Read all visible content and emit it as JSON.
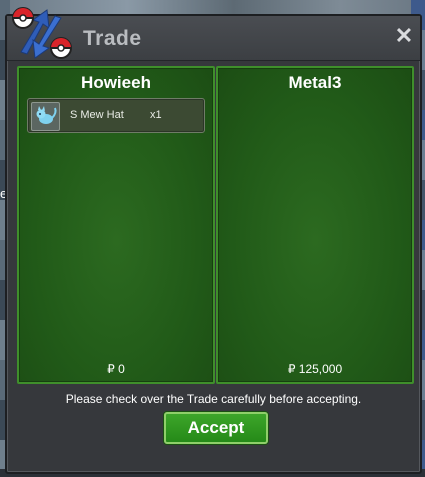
{
  "window": {
    "title": "Trade",
    "close_label": "✕"
  },
  "left_panel": {
    "player": "Howieeh",
    "items": [
      {
        "name": "S Mew Hat",
        "qty": "x1",
        "icon": "mew-icon"
      }
    ],
    "money": "₽ 0"
  },
  "right_panel": {
    "player": "Metal3",
    "items": [],
    "money": "₽ 125,000"
  },
  "footer": {
    "notice": "Please check over the Trade carefully before accepting.",
    "accept_label": "Accept"
  },
  "background": {
    "letter": "e"
  },
  "colors": {
    "panel_green": "#215a18",
    "panel_border": "#3f8f2b",
    "accept_green": "#2f9a22",
    "window_bg": "#36383c"
  }
}
